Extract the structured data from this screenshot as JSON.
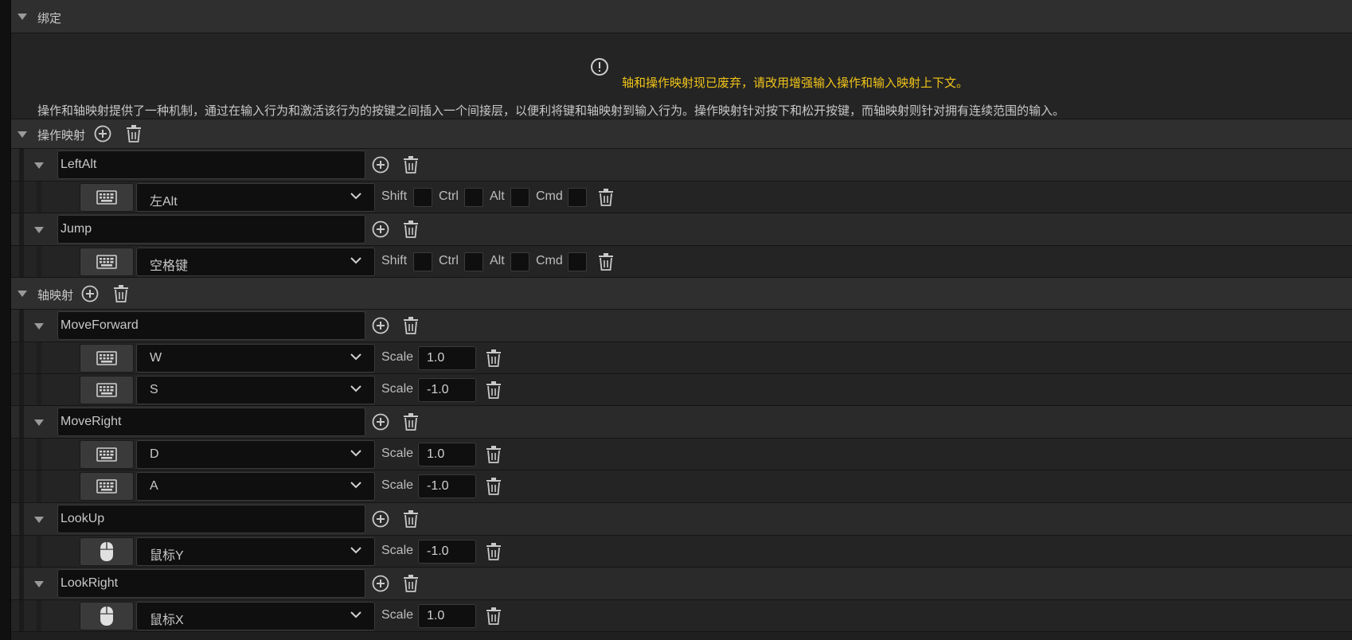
{
  "bindings": {
    "title": "绑定",
    "warning": "轴和操作映射现已废弃，请改用增强输入操作和输入映射上下文。",
    "description": "操作和轴映射提供了一种机制，通过在输入行为和激活该行为的按键之间插入一个间接层，以便利将键和轴映射到输入行为。操作映射针对按下和松开按键，而轴映射则针对拥有连续范围的输入。"
  },
  "action_mappings": {
    "title": "操作映射",
    "modifiers": [
      "Shift",
      "Ctrl",
      "Alt",
      "Cmd"
    ],
    "items": [
      {
        "name": "LeftAlt",
        "keys": [
          {
            "device": "keyboard-icon",
            "key": "左Alt"
          }
        ]
      },
      {
        "name": "Jump",
        "keys": [
          {
            "device": "keyboard-icon",
            "key": "空格键"
          }
        ]
      }
    ]
  },
  "axis_mappings": {
    "title": "轴映射",
    "scale_label": "Scale",
    "items": [
      {
        "name": "MoveForward",
        "keys": [
          {
            "device": "keyboard-icon",
            "key": "W",
            "scale": "1.0"
          },
          {
            "device": "keyboard-icon",
            "key": "S",
            "scale": "-1.0"
          }
        ]
      },
      {
        "name": "MoveRight",
        "keys": [
          {
            "device": "keyboard-icon",
            "key": "D",
            "scale": "1.0"
          },
          {
            "device": "keyboard-icon",
            "key": "A",
            "scale": "-1.0"
          }
        ]
      },
      {
        "name": "LookUp",
        "keys": [
          {
            "device": "mouse-icon",
            "key": "鼠标Y",
            "scale": "-1.0"
          }
        ]
      },
      {
        "name": "LookRight",
        "keys": [
          {
            "device": "mouse-icon",
            "key": "鼠标X",
            "scale": "1.0"
          }
        ]
      }
    ]
  },
  "colors": {
    "warning": "#f0c419",
    "panel": "#242424",
    "header": "#2f2f2f",
    "field": "#0f0f0f"
  }
}
